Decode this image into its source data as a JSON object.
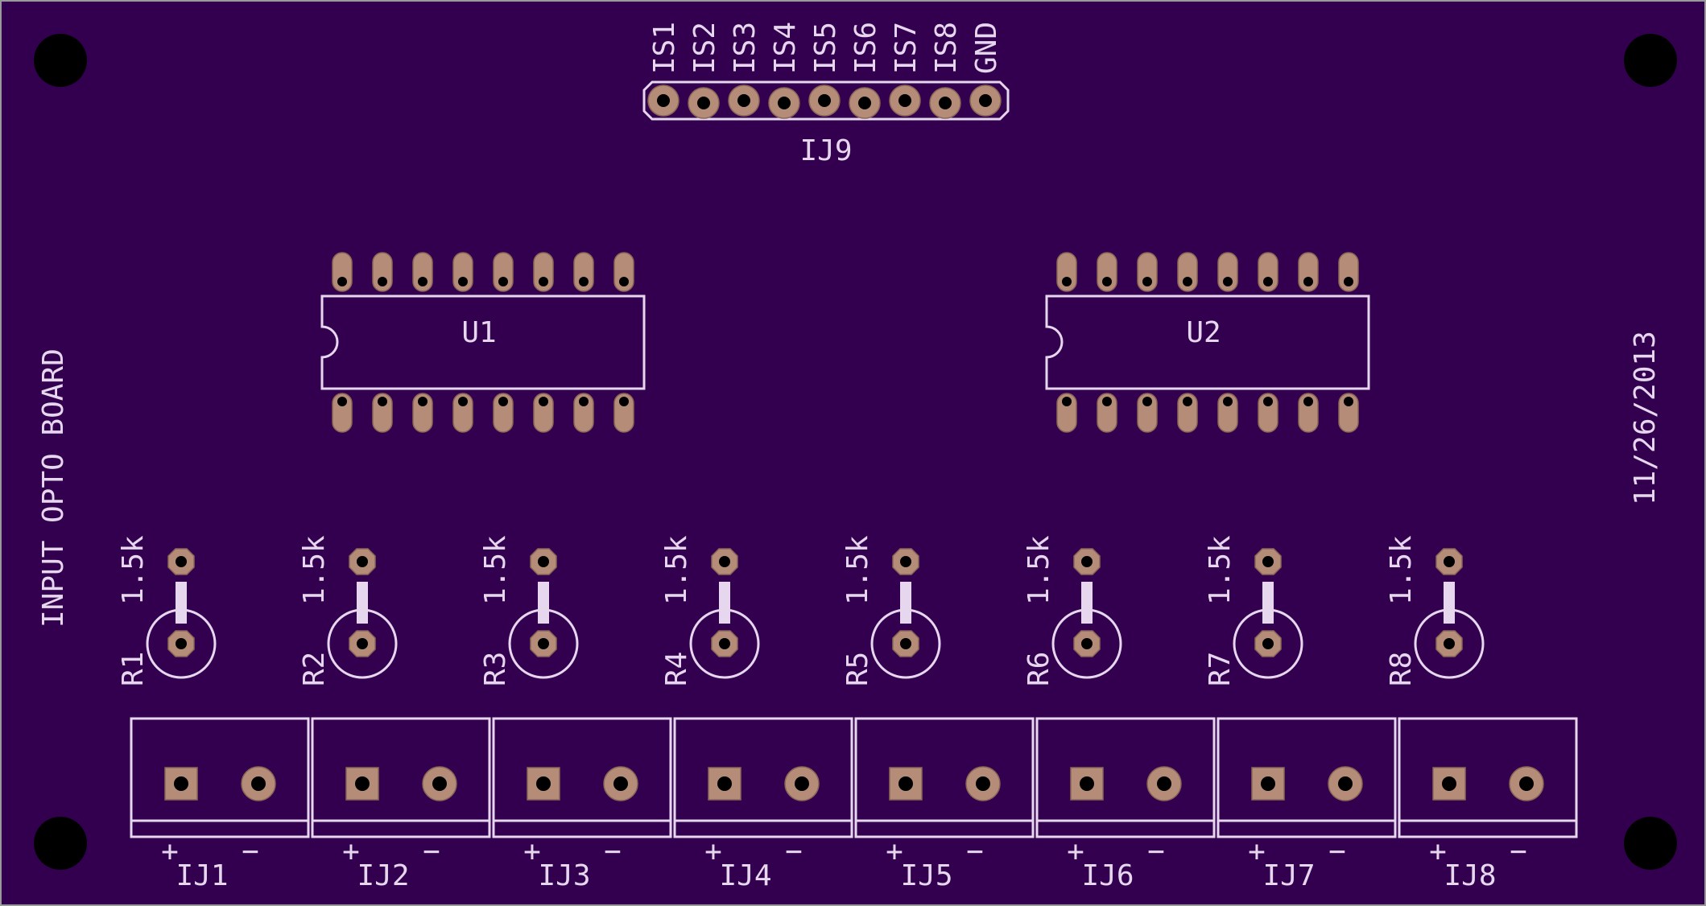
{
  "board": {
    "title": "INPUT OPTO BOARD",
    "date": "11/26/2013",
    "colors": {
      "substrate": "#33004f",
      "silkscreen": "#e6d6ee",
      "copper_pad": "#b48c78",
      "drill": "#000000"
    }
  },
  "header": {
    "designator": "IJ9",
    "pin_labels": [
      "IS1",
      "IS2",
      "IS3",
      "IS4",
      "IS5",
      "IS6",
      "IS7",
      "IS8",
      "GND"
    ]
  },
  "chips": [
    {
      "designator": "U1"
    },
    {
      "designator": "U2"
    }
  ],
  "resistors": [
    {
      "designator": "R1",
      "value": "1.5k"
    },
    {
      "designator": "R2",
      "value": "1.5k"
    },
    {
      "designator": "R3",
      "value": "1.5k"
    },
    {
      "designator": "R4",
      "value": "1.5k"
    },
    {
      "designator": "R5",
      "value": "1.5k"
    },
    {
      "designator": "R6",
      "value": "1.5k"
    },
    {
      "designator": "R7",
      "value": "1.5k"
    },
    {
      "designator": "R8",
      "value": "1.5k"
    }
  ],
  "connectors": [
    {
      "designator": "IJ1",
      "plus": "+",
      "minus": "−"
    },
    {
      "designator": "IJ2",
      "plus": "+",
      "minus": "−"
    },
    {
      "designator": "IJ3",
      "plus": "+",
      "minus": "−"
    },
    {
      "designator": "IJ4",
      "plus": "+",
      "minus": "−"
    },
    {
      "designator": "IJ5",
      "plus": "+",
      "minus": "−"
    },
    {
      "designator": "IJ6",
      "plus": "+",
      "minus": "−"
    },
    {
      "designator": "IJ7",
      "plus": "+",
      "minus": "−"
    },
    {
      "designator": "IJ8",
      "plus": "+",
      "minus": "−"
    }
  ]
}
